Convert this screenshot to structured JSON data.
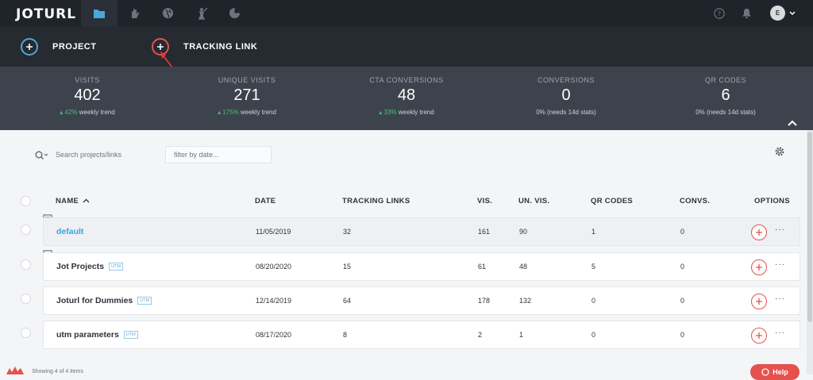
{
  "brand": {
    "logo_text": "JOTURL"
  },
  "nav": {
    "tabs": [
      {
        "icon": "folder-icon",
        "active": true
      },
      {
        "icon": "hand-icon",
        "active": false
      },
      {
        "icon": "globe-icon",
        "active": false
      },
      {
        "icon": "golfer-icon",
        "active": false
      },
      {
        "icon": "pie-chart-icon",
        "active": false
      }
    ],
    "avatar_initial": "E"
  },
  "create": {
    "project_label": "PROJECT",
    "tracking_link_label": "TRACKING LINK"
  },
  "stats": [
    {
      "label": "VISITS",
      "value": "402",
      "trend_pct": "42%",
      "trend_text": "weekly trend"
    },
    {
      "label": "UNIQUE VISITS",
      "value": "271",
      "trend_pct": "175%",
      "trend_text": "weekly trend"
    },
    {
      "label": "CTA CONVERSIONS",
      "value": "48",
      "trend_pct": "33%",
      "trend_text": "weekly trend"
    },
    {
      "label": "CONVERSIONS",
      "value": "0",
      "trend_pct": "",
      "trend_text": "0% (needs 14d stats)"
    },
    {
      "label": "QR CODES",
      "value": "6",
      "trend_pct": "",
      "trend_text": "0% (needs 14d stats)"
    }
  ],
  "search": {
    "placeholder": "Search projects/links"
  },
  "date_filter": {
    "placeholder": "filter by date..."
  },
  "table": {
    "headers": {
      "name": "NAME",
      "date": "DATE",
      "tracking_links": "TRACKING LINKS",
      "vis": "VIS.",
      "un_vis": "UN. VIS.",
      "qr_codes": "QR CODES",
      "convs": "CONVS.",
      "options": "OPTIONS"
    },
    "rows": [
      {
        "name": "default",
        "utm": "",
        "date": "11/05/2019",
        "tracking_links": "32",
        "vis": "161",
        "un_vis": "90",
        "qr_codes": "1",
        "convs": "0"
      },
      {
        "name": "Jot Projects",
        "utm": "UTM",
        "date": "08/20/2020",
        "tracking_links": "15",
        "vis": "61",
        "un_vis": "48",
        "qr_codes": "5",
        "convs": "0"
      },
      {
        "name": "Joturl for Dummies",
        "utm": "UTM",
        "date": "12/14/2019",
        "tracking_links": "64",
        "vis": "178",
        "un_vis": "132",
        "qr_codes": "0",
        "convs": "0"
      },
      {
        "name": "utm parameters",
        "utm": "UTM",
        "date": "08/17/2020",
        "tracking_links": "8",
        "vis": "2",
        "un_vis": "1",
        "qr_codes": "0",
        "convs": "0"
      }
    ],
    "more_glyph": "···"
  },
  "footer": {
    "showing_text": "Showing 4 of 4 items"
  },
  "help": {
    "label": "Help"
  },
  "colors": {
    "accent_blue": "#4aa8d8",
    "accent_red": "#e5524e",
    "trend_green": "#45c07a"
  }
}
